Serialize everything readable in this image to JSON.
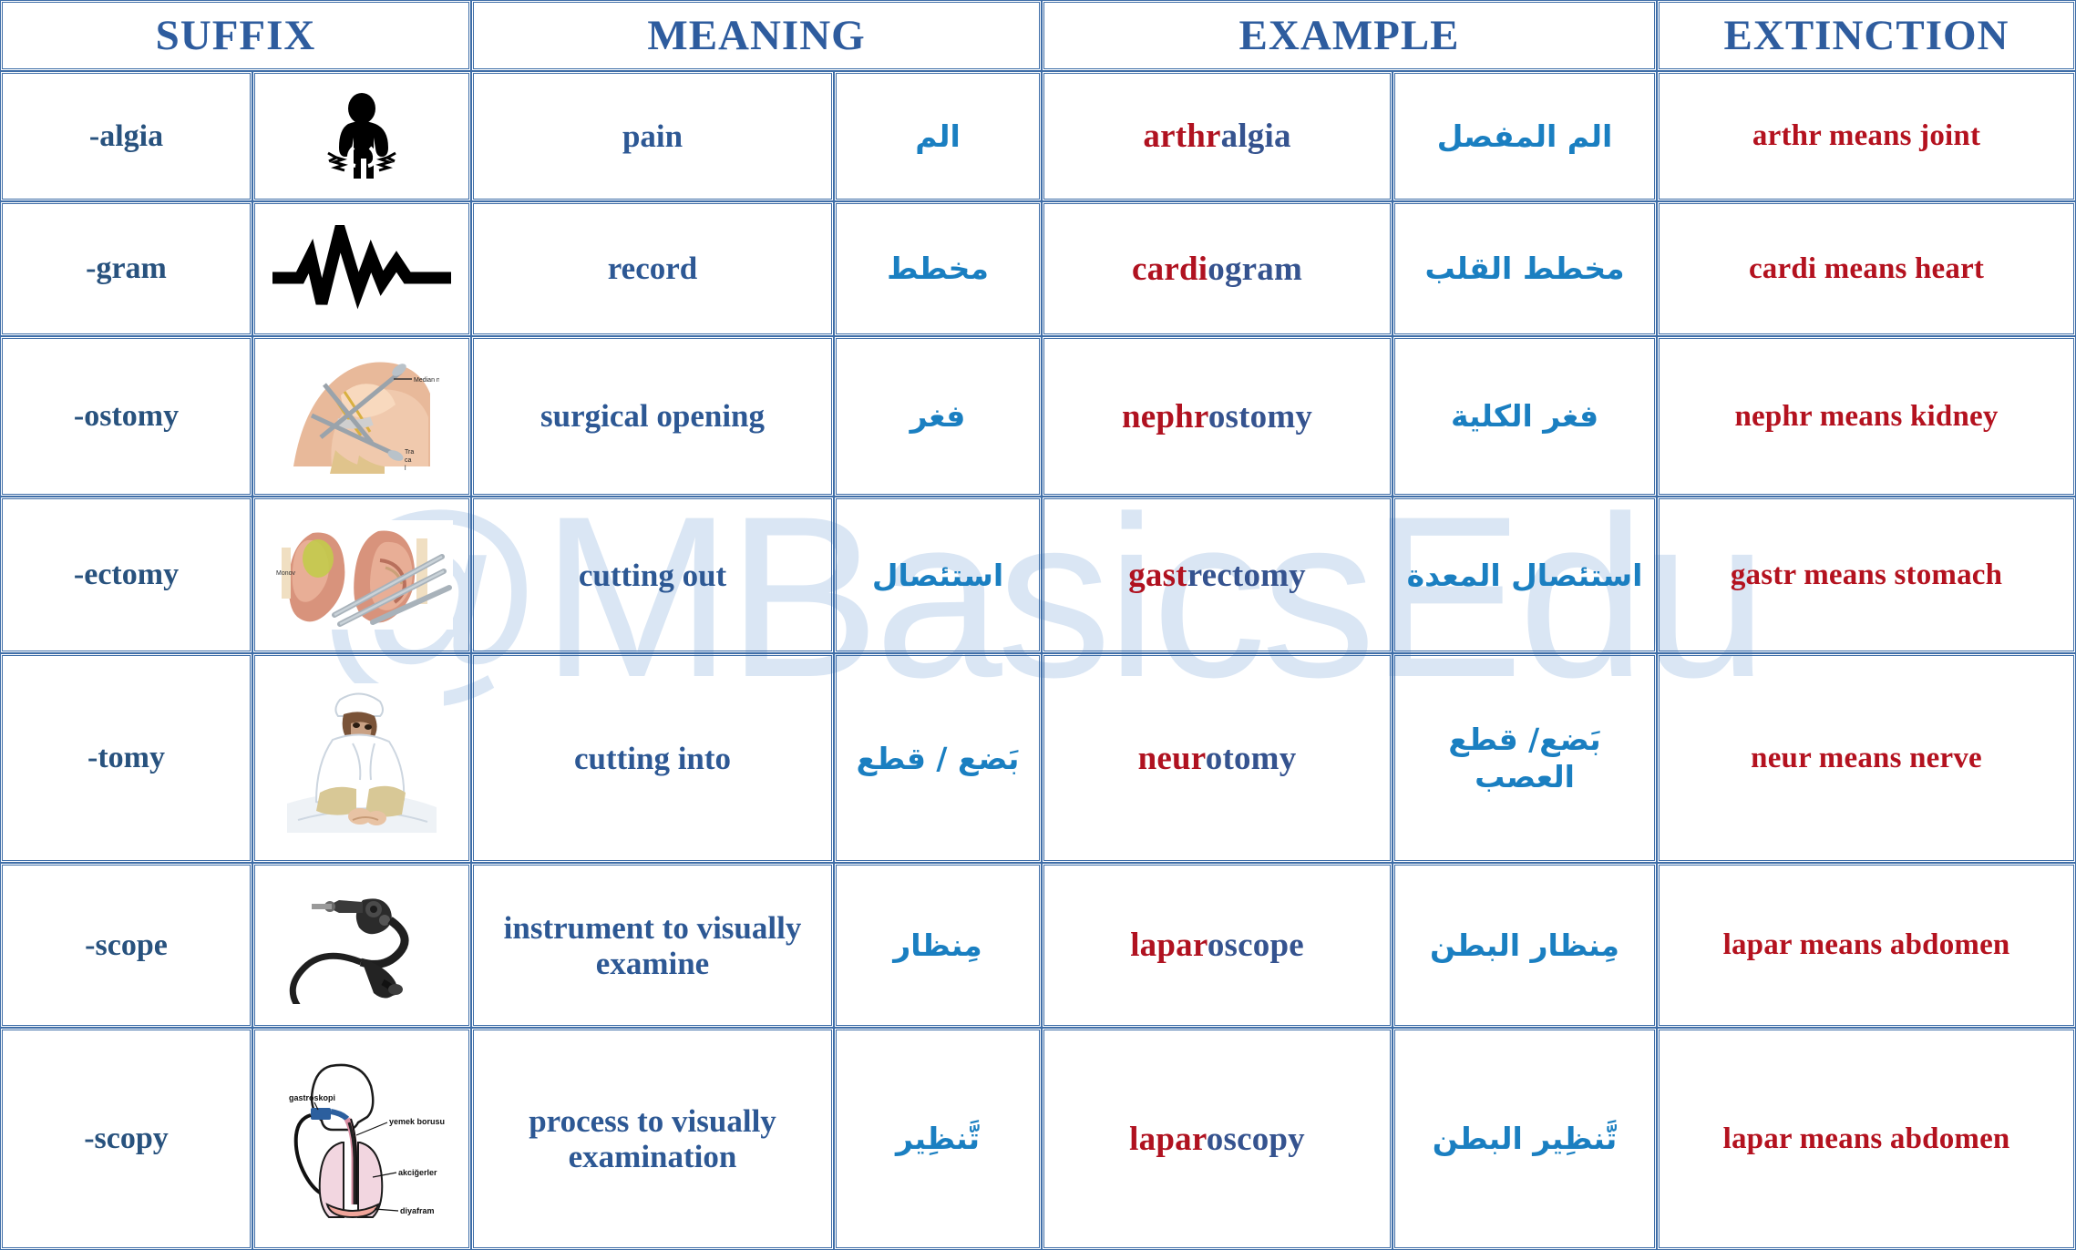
{
  "watermark": {
    "text": "@MBasicsEdu",
    "color": "#dae6f4"
  },
  "table": {
    "headers": {
      "suffix": "SUFFIX",
      "meaning": "MEANING",
      "example": "EXAMPLE",
      "extinction": "EXTINCTION"
    },
    "colors": {
      "header_blue": "#2e5c9e",
      "border_blue": "#3f6ea8",
      "suffix_blue": "#28527e",
      "meaning_blue": "#2d5894",
      "arabic_blue": "#1a7fc1",
      "root_red": "#b01220",
      "extinction_red": "#b4121f"
    },
    "rows": [
      {
        "suffix": "-algia",
        "icon": "person-in-pain-icon",
        "meaning_en": "pain",
        "meaning_ar": "الم",
        "example_root": "arthr",
        "example_suffix": "algia",
        "example_ar": "الم المفصل",
        "extinction": "arthr means joint"
      },
      {
        "suffix": "-gram",
        "icon": "ecg-waveform-icon",
        "meaning_en": "record",
        "meaning_ar": "مخطط",
        "example_root": "cardi",
        "example_suffix": "ogram",
        "example_ar": "مخطط القلب",
        "extinction": "cardi means heart"
      },
      {
        "suffix": "-ostomy",
        "icon": "surgical-hand-incision-icon",
        "meaning_en": "surgical opening",
        "meaning_ar": "فغر",
        "example_root": "nephr",
        "example_suffix": "ostomy",
        "example_ar": "فغر الكلية",
        "extinction": "nephr means kidney"
      },
      {
        "suffix": "-ectomy",
        "icon": "kidney-excision-icon",
        "meaning_en": "cutting out",
        "meaning_ar": "استئصال",
        "example_root": "gast",
        "example_suffix": "rectomy",
        "example_ar": "استئصال المعدة",
        "extinction": "gastr means stomach"
      },
      {
        "suffix": "-tomy",
        "icon": "surgeon-operating-icon",
        "meaning_en": "cutting into",
        "meaning_ar": "بَضع / قطع",
        "example_root": "neur",
        "example_suffix": "otomy",
        "example_ar": "بَضع/ قطع العصب",
        "extinction": "neur means nerve"
      },
      {
        "suffix": "-scope",
        "icon": "endoscope-icon",
        "meaning_en": "instrument to visually examine",
        "meaning_ar": "مِنظار",
        "example_root": "lapar",
        "example_suffix": "oscope",
        "example_ar": "مِنظار البطن",
        "extinction": "lapar means abdomen"
      },
      {
        "suffix": "-scopy",
        "icon": "gastroscopy-diagram-icon",
        "meaning_en": "process to visually examination",
        "meaning_ar": "تَّنظِير",
        "example_root": "lapar",
        "example_suffix": "oscopy",
        "example_ar": "تَّنظِير البطن",
        "extinction": "lapar means abdomen"
      }
    ]
  },
  "icon_labels": {
    "ostomy_median_nerve": "Median nerve",
    "ostomy_transverse": "Tra",
    "ostomy_carpal": "ca",
    "ostomy_lig": "l",
    "ectomy_marker": "Monov",
    "scopy_gastroskopi": "gastroskopi",
    "scopy_yemek": "yemek borusu",
    "scopy_akcigerler": "akciğerler",
    "scopy_diyafram": "diyafram"
  }
}
